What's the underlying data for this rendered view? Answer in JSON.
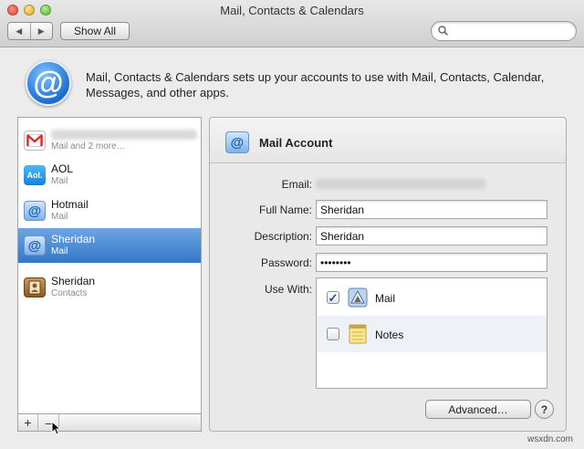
{
  "window": {
    "title": "Mail, Contacts & Calendars"
  },
  "toolbar": {
    "back_glyph": "◀",
    "forward_glyph": "▶",
    "show_all_label": "Show All",
    "search_placeholder": ""
  },
  "header": {
    "icon_glyph": "@",
    "description": "Mail, Contacts & Calendars sets up your accounts to use with Mail, Contacts, Calendar, Messages, and other apps."
  },
  "accounts": [
    {
      "name": "",
      "type": "Mail and 2 more…",
      "icon": "gmail-icon"
    },
    {
      "name": "AOL",
      "type": "Mail",
      "icon": "aol-icon",
      "icon_text": "Aol."
    },
    {
      "name": "Hotmail",
      "type": "Mail",
      "icon": "mail-account-icon",
      "icon_text": "@"
    },
    {
      "name": "Sheridan",
      "type": "Mail",
      "icon": "mail-account-icon",
      "icon_text": "@",
      "selected": true
    },
    {
      "name": "Sheridan",
      "type": "Contacts",
      "icon": "contacts-icon"
    }
  ],
  "list_toolbar": {
    "add_label": "+",
    "remove_label": "–"
  },
  "detail": {
    "title": "Mail Account",
    "icon_text": "@",
    "email_label": "Email:",
    "full_name_label": "Full Name:",
    "full_name_value": "Sheridan",
    "description_label": "Description:",
    "description_value": "Sheridan",
    "password_label": "Password:",
    "password_value": "password",
    "use_with_label": "Use With:",
    "use_with": [
      {
        "label": "Mail",
        "checked": true,
        "check_glyph": "✓",
        "icon": "mail-app-icon"
      },
      {
        "label": "Notes",
        "checked": false,
        "check_glyph": "",
        "icon": "notes-app-icon"
      }
    ],
    "advanced_label": "Advanced…",
    "help_label": "?"
  },
  "watermark": "wsxdn.com",
  "colors": {
    "selection": "#3577c9",
    "accent": "#1f6fd1"
  }
}
